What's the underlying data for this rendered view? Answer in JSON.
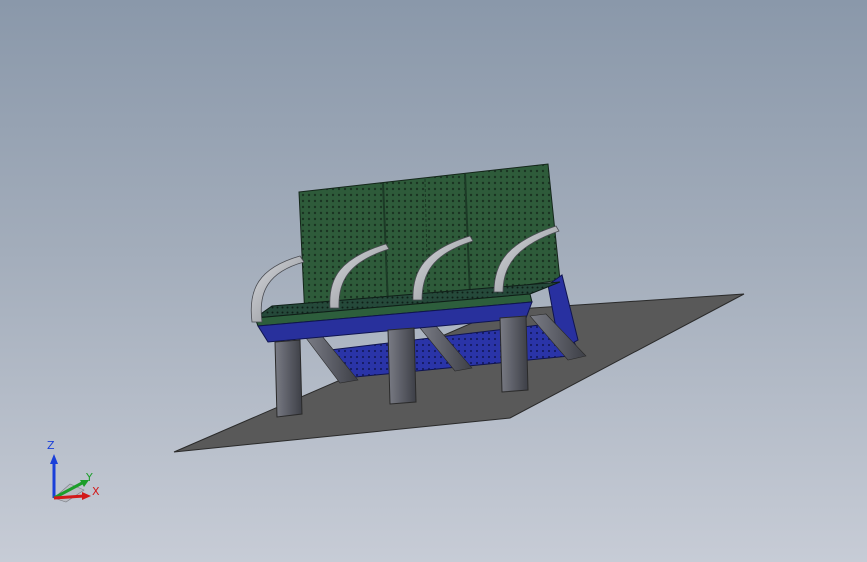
{
  "viewport": {
    "background_top": "#8a98aa",
    "background_bottom": "#c7ccd6"
  },
  "model": {
    "ground_plate_color": "#595959",
    "backrest_color": "#2e5b3a",
    "seat_color": "#2d5e3c",
    "frame_color": "#28309c",
    "leg_color": "#5b5d66",
    "armrest_color": "#a7aab0"
  },
  "triad": {
    "z_label": "Z",
    "y_label": "Y",
    "x_label": "X",
    "z_color": "#1a3fd9",
    "y_color": "#1c9e2a",
    "x_color": "#d21a1a"
  }
}
